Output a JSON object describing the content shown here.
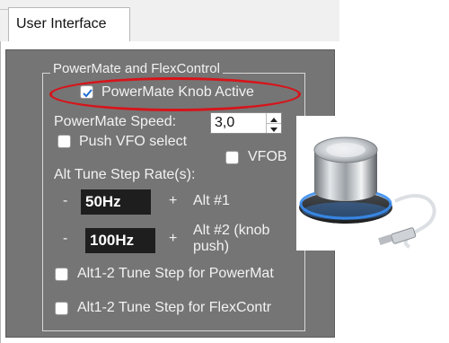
{
  "tab": {
    "label": "User Interface"
  },
  "group": {
    "title": "PowerMate and FlexControl"
  },
  "knob_active": {
    "label": "PowerMate Knob Active",
    "checked": true
  },
  "speed": {
    "label": "PowerMate Speed:",
    "value": "3,0"
  },
  "push_vfo": {
    "label": "Push VFO select",
    "checked": false
  },
  "vfob": {
    "label": "VFOB",
    "checked": false
  },
  "alt_tune": {
    "label": "Alt Tune Step Rate(s):",
    "rows": [
      {
        "minus": "-",
        "value": "50Hz",
        "plus": "+",
        "label": "Alt #1"
      },
      {
        "minus": "-",
        "value": "100Hz",
        "plus": "+",
        "label_line1": "Alt #2 (knob",
        "label_line2": "push)"
      }
    ]
  },
  "alt12_powermate": {
    "label": "Alt1-2 Tune Step for PowerMat",
    "checked": false
  },
  "alt12_flexcontrol": {
    "label": "Alt1-2 Tune Step for FlexContr",
    "checked": false
  },
  "colors": {
    "panel": "#757575",
    "highlight": "#d7141a",
    "check_accent": "#1f6fd1",
    "knob_glow": "#3a8df0"
  }
}
